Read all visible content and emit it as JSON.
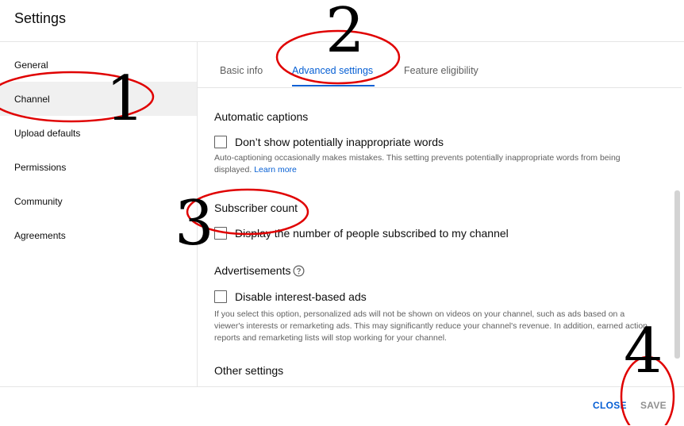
{
  "header": {
    "title": "Settings"
  },
  "sidebar": {
    "items": [
      {
        "label": "General"
      },
      {
        "label": "Channel"
      },
      {
        "label": "Upload defaults"
      },
      {
        "label": "Permissions"
      },
      {
        "label": "Community"
      },
      {
        "label": "Agreements"
      }
    ]
  },
  "tabs": [
    {
      "label": "Basic info"
    },
    {
      "label": "Advanced settings"
    },
    {
      "label": "Feature eligibility"
    }
  ],
  "sections": {
    "captions": {
      "title": "Automatic captions",
      "checkbox_label": "Don’t show potentially inappropriate words",
      "description": "Auto-captioning occasionally makes mistakes. This setting prevents potentially inappropriate words from being displayed.",
      "link": "Learn more"
    },
    "subscriber": {
      "title": "Subscriber count",
      "checkbox_label": "Display the number of people subscribed to my channel"
    },
    "ads": {
      "title": "Advertisements",
      "checkbox_label": "Disable interest-based ads",
      "description": "If you select this option, personalized ads will not be shown on videos on your channel, such as ads based on a viewer's interests or remarketing ads. This may significantly reduce your channel's revenue. In addition, earned action reports and remarketing lists will stop working for your channel."
    },
    "other": {
      "title": "Other settings"
    }
  },
  "footer": {
    "close_label": "CLOSE",
    "save_label": "SAVE"
  },
  "annotations": {
    "n1": "1",
    "n2": "2",
    "n3": "3",
    "n4": "4"
  },
  "colors": {
    "accent": "#065fd4",
    "annotation": "#e00000"
  }
}
